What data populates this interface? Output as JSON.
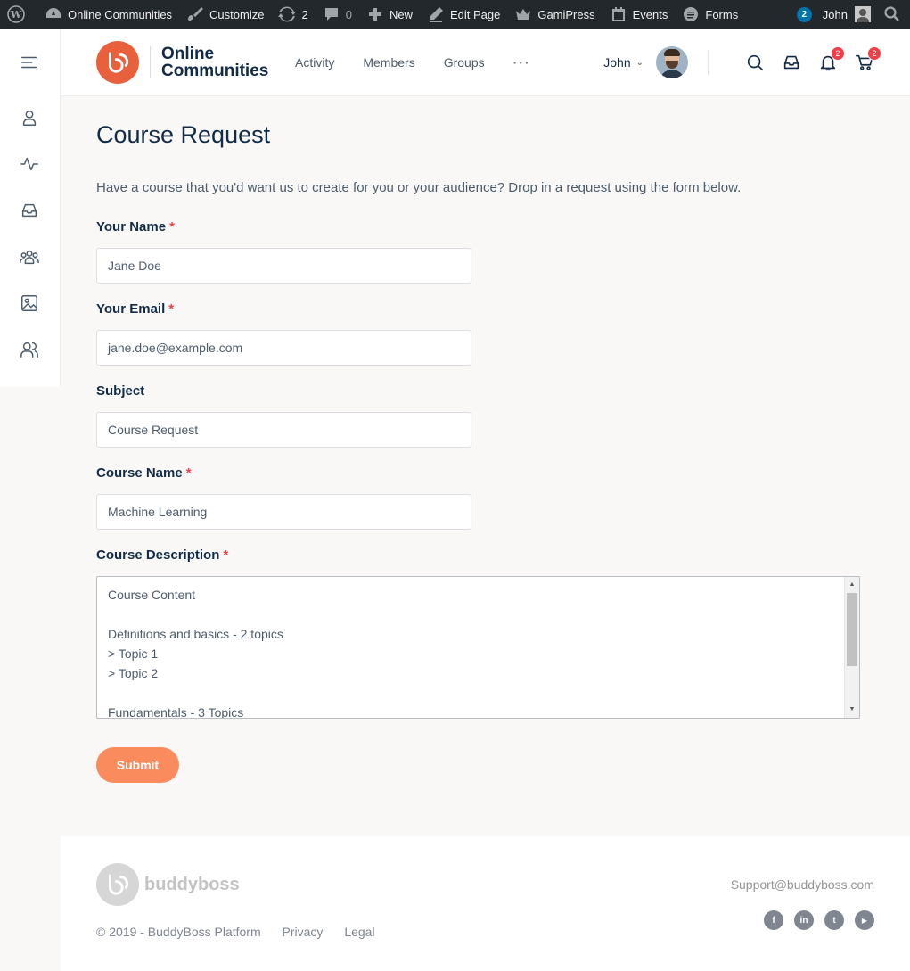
{
  "adminbar": {
    "site_name": "Online Communities",
    "customize": "Customize",
    "updates_count": "2",
    "comments_count": "0",
    "new": "New",
    "edit_page": "Edit Page",
    "gamipress": "GamiPress",
    "events": "Events",
    "forms": "Forms",
    "notif_count": "2",
    "user": "John"
  },
  "header": {
    "logo_line1": "Online",
    "logo_line2": "Communities",
    "nav": [
      "Activity",
      "Members",
      "Groups",
      "···"
    ],
    "user_name": "John",
    "notifications_count": "2",
    "cart_count": "2"
  },
  "page": {
    "title": "Course Request",
    "intro": "Have a course that you'd want us to create for you or your audience? Drop in a request using the form below."
  },
  "form": {
    "name_label": "Your Name",
    "name_value": "Jane Doe",
    "email_label": "Your Email",
    "email_value": "jane.doe@example.com",
    "subject_label": "Subject",
    "subject_value": "Course Request",
    "course_name_label": "Course Name",
    "course_name_value": "Machine Learning",
    "description_label": "Course Description",
    "description_value": "Course Content\n\nDefinitions and basics - 2 topics\n> Topic 1\n> Topic 2\n\nFundamentals - 3 Topics",
    "required_mark": "*",
    "submit_label": "Submit"
  },
  "footer": {
    "brand": "buddyboss",
    "copyright": "©  2019 - BuddyBoss Platform",
    "privacy": "Privacy",
    "legal": "Legal",
    "support_email": "Support@buddyboss.com",
    "social": [
      "f",
      "in",
      "t",
      "▶"
    ]
  }
}
